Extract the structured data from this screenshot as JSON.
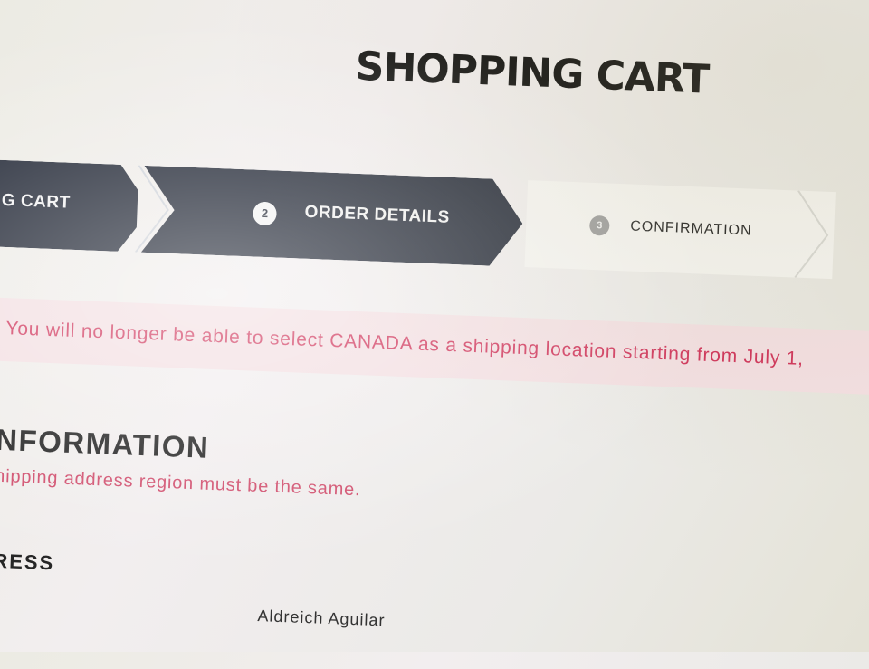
{
  "page": {
    "title": "SHOPPING CART"
  },
  "stepper": {
    "steps": [
      {
        "number": "",
        "label": "G CART"
      },
      {
        "number": "2",
        "label": "ORDER DETAILS"
      },
      {
        "number": "3",
        "label": "CONFIRMATION"
      }
    ]
  },
  "alert": {
    "text": "You will no longer be able to select CANADA as a shipping location starting from July 1,"
  },
  "section": {
    "title": "G INFORMATION",
    "note": "d shipping address region must be the same."
  },
  "address": {
    "label": "DDRESS",
    "name_value": "Aldreich Aguilar"
  },
  "colors": {
    "stepper_active": "#1f2533",
    "alert_bg": "#f3dfe2",
    "alert_text": "#d0355b"
  }
}
